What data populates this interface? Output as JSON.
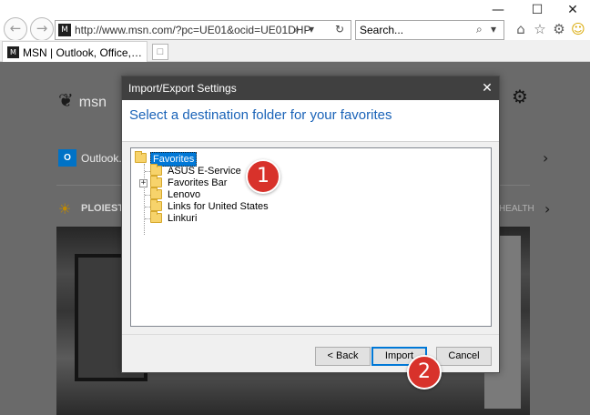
{
  "browser": {
    "address": {
      "url": "http://www.msn.com/?pc=UE01&ocid=UE01DHP",
      "site_icon": "msn-icon",
      "search_icon": "search-icon",
      "refresh_icon": "refresh-icon"
    },
    "search": {
      "placeholder": "Search...",
      "search_icon": "search-icon",
      "dropdown_icon": "chevron-down-icon"
    },
    "window_controls": [
      "minimize",
      "maximize",
      "close"
    ],
    "toolbar_icons": [
      "home-icon",
      "favorites-star-icon",
      "settings-gear-icon",
      "feedback-smiley-icon"
    ],
    "tab": {
      "title": "MSN | Outlook, Office, Skype, Bing..."
    }
  },
  "page": {
    "logo_text": "msn",
    "outlook_label": "Outlook.com",
    "city": "PLOIESTI",
    "health_label": "HEALTH"
  },
  "dialog": {
    "title": "Import/Export Settings",
    "heading": "Select a destination folder for your favorites",
    "tree": {
      "root": "Favorites",
      "children": [
        "ASUS E-Service",
        "Favorites Bar",
        "Lenovo",
        "Links for United States",
        "Linkuri"
      ]
    },
    "buttons": {
      "back": "< Back",
      "import": "Import",
      "cancel": "Cancel"
    }
  },
  "callouts": [
    "1",
    "2"
  ],
  "colors": {
    "accent": "#0078d7",
    "heading": "#1a63b8",
    "dialog_titlebar": "#404040",
    "callout": "#d8322b"
  }
}
